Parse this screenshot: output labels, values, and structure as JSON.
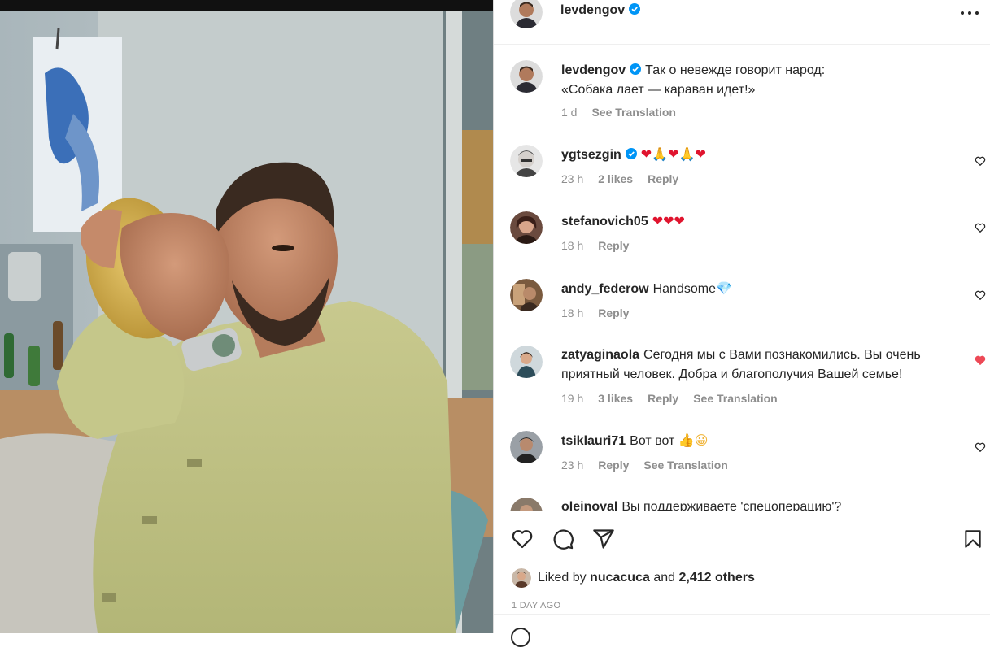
{
  "post": {
    "author": "levdengov",
    "caption_line1": "Так о невежде говорит народ:",
    "caption_line2": "«Собака лает — караван идет!»",
    "caption_time": "1 d",
    "see_translation": "See Translation",
    "more_icon": "more-horizontal-icon"
  },
  "comments": [
    {
      "username": "ygtsezgin",
      "verified": true,
      "text": "",
      "emoji": [
        "❤",
        "🙏",
        "❤",
        "🙏",
        "❤"
      ],
      "time": "23 h",
      "likes": "2 likes",
      "reply": "Reply",
      "translation": "",
      "liked": false
    },
    {
      "username": "stefanovich05",
      "verified": false,
      "text": "",
      "emoji": [
        "❤",
        "❤",
        "❤"
      ],
      "time": "18 h",
      "likes": "",
      "reply": "Reply",
      "translation": "",
      "liked": false
    },
    {
      "username": "andy_federow",
      "verified": false,
      "text": "Handsome",
      "emoji": [
        "💎"
      ],
      "time": "18 h",
      "likes": "",
      "reply": "Reply",
      "translation": "",
      "liked": false
    },
    {
      "username": "zatyaginaola",
      "verified": false,
      "text_line1": "Сегодня мы с Вами познакомились. Вы очень",
      "text_line2": "приятный человек. Добра и благополучия Вашей семье!",
      "time": "19 h",
      "likes": "3 likes",
      "reply": "Reply",
      "translation": "See Translation",
      "liked": true
    },
    {
      "username": "tsiklauri71",
      "verified": false,
      "text": "Вот вот",
      "emoji": [
        "👍",
        "😀"
      ],
      "time": "23 h",
      "likes": "",
      "reply": "Reply",
      "translation": "See Translation",
      "liked": false
    },
    {
      "username": "olejnoval",
      "verified": false,
      "text": "Вы поддерживаете 'спецоперацию'?",
      "time": "",
      "likes": "",
      "reply": "",
      "translation": "",
      "liked": false
    }
  ],
  "actions": {
    "like_icon": "heart-outline-icon",
    "comment_icon": "comment-bubble-icon",
    "share_icon": "paper-plane-icon",
    "save_icon": "bookmark-icon"
  },
  "likes": {
    "prefix": "Liked by",
    "user": "nucacuca",
    "and": "and",
    "others": "2,412 others"
  },
  "date": "1 DAY AGO",
  "colors": {
    "verified_blue": "#0095f6",
    "liked_red": "#ed4956",
    "text": "#262626",
    "muted": "#8e8e8e"
  }
}
